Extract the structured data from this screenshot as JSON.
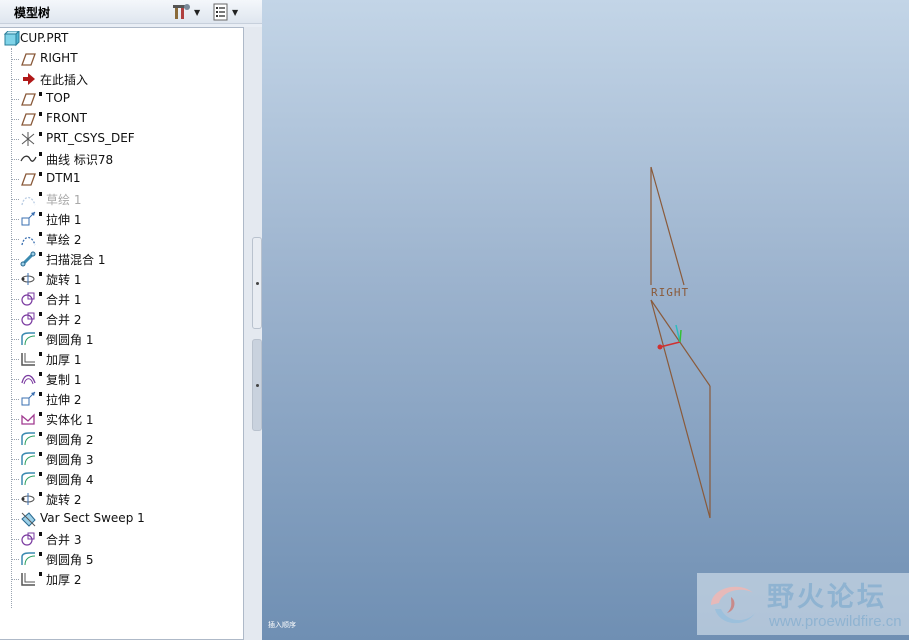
{
  "panel": {
    "title": "模型树",
    "settings_icon": "tree-settings-icon",
    "show_icon": "show-list-icon"
  },
  "tree": {
    "root": {
      "label": "CUP.PRT",
      "icon": "part-icon"
    },
    "items": [
      {
        "label": "RIGHT",
        "icon": "datum-plane-icon",
        "marked": false,
        "suppressed": false
      },
      {
        "label": "在此插入",
        "icon": "insert-arrow-icon",
        "marked": false,
        "suppressed": false
      },
      {
        "label": "TOP",
        "icon": "datum-plane-icon",
        "marked": true,
        "suppressed": false
      },
      {
        "label": "FRONT",
        "icon": "datum-plane-icon",
        "marked": true,
        "suppressed": false
      },
      {
        "label": "PRT_CSYS_DEF",
        "icon": "csys-icon",
        "marked": true,
        "suppressed": false
      },
      {
        "label": "曲线 标识78",
        "icon": "curve-icon",
        "marked": true,
        "suppressed": false
      },
      {
        "label": "DTM1",
        "icon": "datum-plane-icon",
        "marked": true,
        "suppressed": false
      },
      {
        "label": "草绘 1",
        "icon": "sketch-icon",
        "marked": true,
        "suppressed": true
      },
      {
        "label": "拉伸 1",
        "icon": "extrude-icon",
        "marked": true,
        "suppressed": false
      },
      {
        "label": "草绘 2",
        "icon": "sketch-icon",
        "marked": true,
        "suppressed": false
      },
      {
        "label": "扫描混合 1",
        "icon": "swept-blend-icon",
        "marked": true,
        "suppressed": false
      },
      {
        "label": "旋转 1",
        "icon": "revolve-icon",
        "marked": true,
        "suppressed": false
      },
      {
        "label": "合并 1",
        "icon": "merge-icon",
        "marked": true,
        "suppressed": false
      },
      {
        "label": "合并 2",
        "icon": "merge-icon",
        "marked": true,
        "suppressed": false
      },
      {
        "label": "倒圆角 1",
        "icon": "round-icon",
        "marked": true,
        "suppressed": false
      },
      {
        "label": "加厚 1",
        "icon": "thicken-icon",
        "marked": true,
        "suppressed": false
      },
      {
        "label": "复制 1",
        "icon": "copy-icon",
        "marked": true,
        "suppressed": false
      },
      {
        "label": "拉伸 2",
        "icon": "extrude-icon",
        "marked": true,
        "suppressed": false
      },
      {
        "label": "实体化 1",
        "icon": "solidify-icon",
        "marked": true,
        "suppressed": false
      },
      {
        "label": "倒圆角 2",
        "icon": "round-icon",
        "marked": true,
        "suppressed": false
      },
      {
        "label": "倒圆角 3",
        "icon": "round-icon",
        "marked": true,
        "suppressed": false
      },
      {
        "label": "倒圆角 4",
        "icon": "round-icon",
        "marked": true,
        "suppressed": false
      },
      {
        "label": "旋转 2",
        "icon": "revolve-icon",
        "marked": true,
        "suppressed": false
      },
      {
        "label": "Var Sect Sweep 1",
        "icon": "var-sect-sweep-icon",
        "marked": false,
        "suppressed": false
      },
      {
        "label": "合并 3",
        "icon": "merge-icon",
        "marked": true,
        "suppressed": false
      },
      {
        "label": "倒圆角 5",
        "icon": "round-icon",
        "marked": true,
        "suppressed": false
      },
      {
        "label": "加厚 2",
        "icon": "thicken-icon",
        "marked": true,
        "suppressed": false
      }
    ]
  },
  "viewport": {
    "datum_label": "RIGHT",
    "status_text": "插入顺序",
    "colors": {
      "datum": "#8a5a3a",
      "bg_top": "#c3d5e7",
      "bg_bottom": "#6f8fb3"
    }
  },
  "watermark": {
    "title": "野火论坛",
    "url": "www.proewildfire.cn"
  }
}
